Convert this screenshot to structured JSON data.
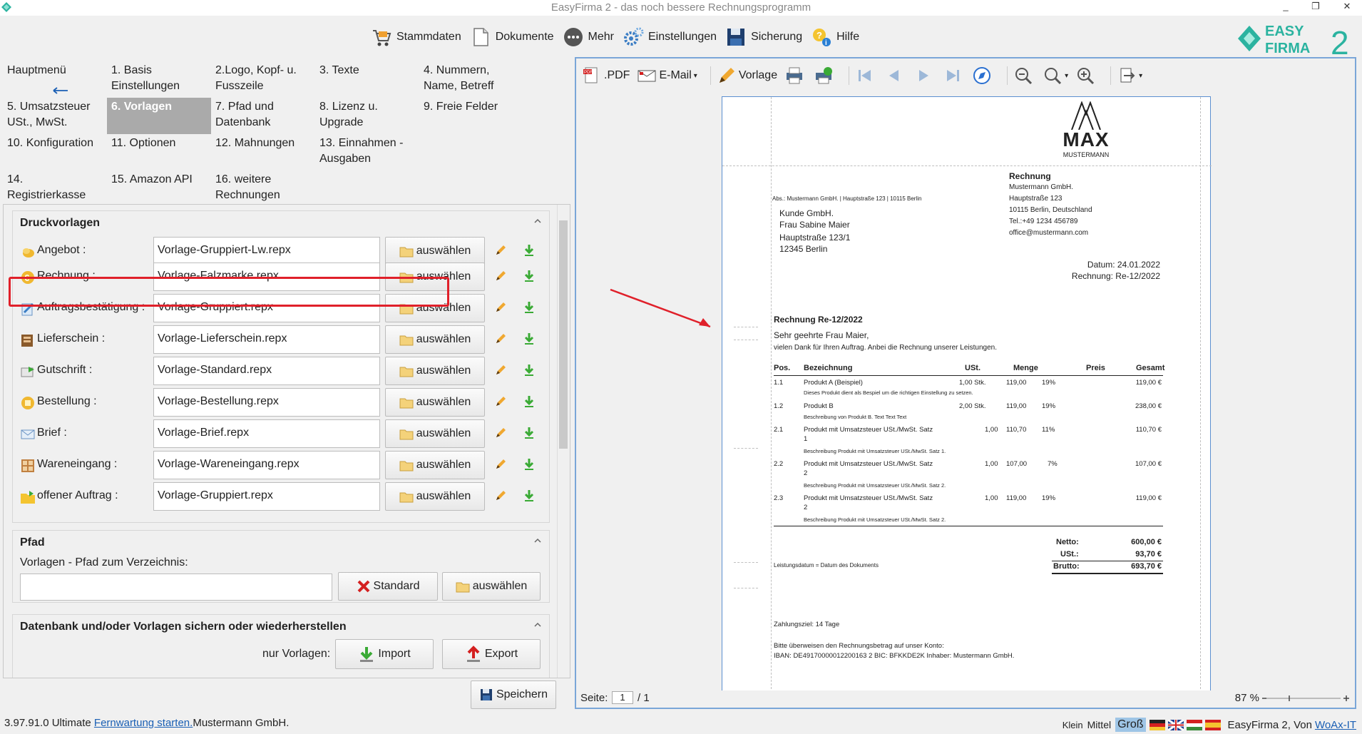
{
  "window": {
    "title": "EasyFirma 2 - das noch bessere Rechnungsprogramm",
    "minimize": "_",
    "restore": "❐",
    "close": "✕"
  },
  "toolbar": {
    "items": [
      {
        "label": "Stammdaten",
        "icon": "cart-icon"
      },
      {
        "label": "Dokumente",
        "icon": "document-icon"
      },
      {
        "label": "Mehr",
        "icon": "more-icon"
      },
      {
        "label": "Einstellungen",
        "icon": "gears-icon"
      },
      {
        "label": "Sicherung",
        "icon": "floppy-icon"
      },
      {
        "label": "Hilfe",
        "icon": "help-icon"
      }
    ]
  },
  "logo": {
    "line1": "EASY",
    "line2": "FIRMA",
    "number": "2"
  },
  "nav": {
    "items": [
      {
        "label": "Hauptmenü"
      },
      {
        "label": "1. Basis Einstellungen"
      },
      {
        "label": "2.Logo, Kopf- u. Fusszeile"
      },
      {
        "label": "3. Texte"
      },
      {
        "label": "4. Nummern, Name, Betreff"
      },
      {
        "label": "5. Umsatzsteuer USt., MwSt."
      },
      {
        "label": "6. Vorlagen"
      },
      {
        "label": "7. Pfad und Datenbank"
      },
      {
        "label": "8. Lizenz u. Upgrade"
      },
      {
        "label": "9. Freie Felder"
      },
      {
        "label": "10. Konfiguration"
      },
      {
        "label": "11. Optionen"
      },
      {
        "label": "12. Mahnungen"
      },
      {
        "label": "13. Einnahmen - Ausgaben"
      },
      {
        "label": "14. Registrierkasse"
      },
      {
        "label": "15. Amazon API"
      },
      {
        "label": "16. weitere Rechnungen"
      }
    ],
    "active_index": 6
  },
  "druckvorlagen": {
    "title": "Druckvorlagen",
    "button_label": "auswählen",
    "rows": [
      {
        "label": "Angebot :",
        "value": "Vorlage-Gruppiert-Lw.repx"
      },
      {
        "label": "Rechnung :",
        "value": "Vorlage-Falzmarke.repx"
      },
      {
        "label": "Auftragsbestätigung :",
        "value": "Vorlage-Gruppiert.repx"
      },
      {
        "label": "Lieferschein :",
        "value": "Vorlage-Lieferschein.repx"
      },
      {
        "label": "Gutschrift :",
        "value": "Vorlage-Standard.repx"
      },
      {
        "label": "Bestellung :",
        "value": "Vorlage-Bestellung.repx"
      },
      {
        "label": "Brief :",
        "value": "Vorlage-Brief.repx"
      },
      {
        "label": "Wareneingang :",
        "value": "Vorlage-Wareneingang.repx"
      },
      {
        "label": "offener Auftrag :",
        "value": "Vorlage-Gruppiert.repx"
      }
    ],
    "highlight_color": "#e0202a"
  },
  "pfad": {
    "title": "Pfad",
    "label": "Vorlagen - Pfad zum Verzeichnis:",
    "value": "",
    "standard_label": "Standard",
    "select_label": "auswählen"
  },
  "backup": {
    "title": "Datenbank und/oder Vorlagen sichern oder wiederherstellen",
    "label": "nur Vorlagen:",
    "import_label": "Import",
    "export_label": "Export"
  },
  "save_label": "Speichern",
  "status": {
    "version": "3.97.91.0 Ultimate",
    "remote_link": "Fernwartung starten.",
    "company": "Mustermann GmbH.",
    "size_small": "Klein",
    "size_medium": "Mittel",
    "size_large": "Groß",
    "credit": "EasyFirma 2, Von",
    "credit_link": "WoAx-IT"
  },
  "viewer": {
    "pdf_label": ".PDF",
    "email_label": "E-Mail",
    "template_label": "Vorlage",
    "page_label": "Seite:",
    "page_value": "1",
    "page_total": "/ 1",
    "zoom": "87 %"
  },
  "invoice": {
    "logo_text": "MAX",
    "logo_sub": "MUSTERMANN",
    "sender_line": "Abs.: Mustermann GmbH. | Hauptstraße 123 | 10115 Berlin",
    "recipient": [
      "Kunde GmbH.",
      "Frau Sabine Maier",
      "Hauptstraße 123/1",
      "12345 Berlin"
    ],
    "info_title": "Rechnung",
    "info_lines": [
      "Mustermann GmbH.",
      "Hauptstraße 123",
      "10115 Berlin, Deutschland",
      "Tel.:+49 1234 456789",
      "office@mustermann.com"
    ],
    "date": "Datum: 24.01.2022",
    "number": "Rechnung: Re-12/2022",
    "subject": "Rechnung Re-12/2022",
    "salutation": "Sehr geehrte Frau Maier,",
    "intro": "vielen Dank für Ihren Auftrag. Anbei die Rechnung unserer Leistungen.",
    "columns": [
      "Pos.",
      "Bezeichnung",
      "USt.",
      "Menge",
      "Preis",
      "Gesamt"
    ],
    "items": [
      {
        "pos": "1.1",
        "name": "Produkt A (Beispiel)",
        "name2": "",
        "ust": "1,00 Stk.",
        "menge": "119,00",
        "preis": "19%",
        "gesamt": "119,00 €",
        "desc": "Dieses Produkt dient als Bespiel um die richtigen Einstellung zu setzen."
      },
      {
        "pos": "1.2",
        "name": "Produkt B",
        "name2": "",
        "ust": "2,00 Stk.",
        "menge": "119,00",
        "preis": "19%",
        "gesamt": "238,00 €",
        "desc": "Beschreibung von Produkt B. Text Text Text"
      },
      {
        "pos": "2.1",
        "name": "Produkt mit Umsatzsteuer USt./MwSt. Satz",
        "name2": "1",
        "ust": "1,00",
        "menge": "110,70",
        "preis": "11%",
        "gesamt": "110,70 €",
        "desc": "Beschreibung Produkt mit Umsatzsteuer USt./MwSt. Satz 1."
      },
      {
        "pos": "2.2",
        "name": "Produkt mit Umsatzsteuer USt./MwSt. Satz",
        "name2": "2",
        "ust": "1,00",
        "menge": "107,00",
        "preis": "7%",
        "gesamt": "107,00 €",
        "desc": "Beschreibung Produkt mit Umsatzsteuer USt./MwSt. Satz 2."
      },
      {
        "pos": "2.3",
        "name": "Produkt mit Umsatzsteuer USt./MwSt. Satz",
        "name2": "2",
        "ust": "1,00",
        "menge": "119,00",
        "preis": "19%",
        "gesamt": "119,00 €",
        "desc": "Beschreibung Produkt mit Umsatzsteuer USt./MwSt. Satz 2."
      }
    ],
    "totals": [
      {
        "label": "Netto:",
        "value": "600,00 €"
      },
      {
        "label": "USt.:",
        "value": "93,70 €"
      },
      {
        "label": "Brutto:",
        "value": "693,70 €"
      }
    ],
    "service_date": "Leistungsdatum = Datum des Dokuments",
    "payment_term": "Zahlungsziel: 14 Tage",
    "bank_line1": "Bitte überweisen den Rechnungsbetrag auf unser Konto:",
    "bank_line2": "IBAN: DE49170000012200163 2  BIC: BFKKDE2K  Inhaber: Mustermann GmbH."
  },
  "colors": {
    "accent_green": "#2bb3a0",
    "viewer_border": "#7aa6d8",
    "arrow": "#e0202a"
  }
}
